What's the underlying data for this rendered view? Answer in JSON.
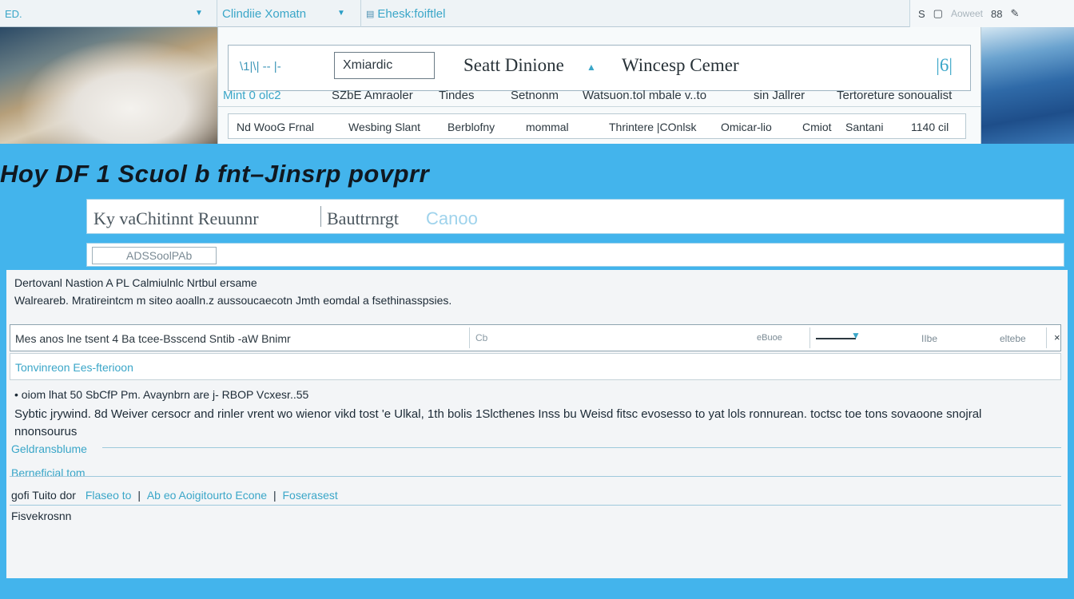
{
  "tabs": [
    {
      "label": "ED.",
      "chev": "▼"
    },
    {
      "label": "Clindiie Xomatn",
      "chev": "▼"
    },
    {
      "label": "Ehesk:foiftlel",
      "icon": "doc-icon"
    }
  ],
  "toolbar": {
    "item1": "S",
    "item2": "▢",
    "item3": "Aoweet",
    "item4": "88",
    "item5": "✎"
  },
  "panel": {
    "row1": {
      "left": "\\1|\\| -- |-",
      "box": "Xmiardic",
      "big1": "Seatt Dinione",
      "chev": "▲",
      "big2": "Wincesp Cemer",
      "end": "|6|"
    },
    "row2": {
      "a": "Mint 0 olc2",
      "b": "SZbE Amraoler",
      "c": "Tindes",
      "d": "Setnonm",
      "e": "Watsuon.tol mbale v..to",
      "f": "sin Jallrer",
      "g": "Tertoreture sonoualist"
    },
    "row3": {
      "a": "Nd WooG Frnal",
      "b": "Wesbing Slant",
      "c": "Berblofny",
      "d": "mommal",
      "e": "Thrintere |COnlsk",
      "f": "Omicar-lio",
      "g": "Cmiot",
      "h": "Santani",
      "i": "1140 cil"
    }
  },
  "heading": "Hoy DF 1 Scuol b fnt–Jinsrp povprr",
  "strip1": {
    "t1": "Ky vaChitinnt Reuunnr",
    "t2": "Bauttrnrgt",
    "t3": "Canoo"
  },
  "strip2": {
    "btn": "ADSSoolPAb"
  },
  "main": {
    "desc1": "Dertovanl Nastion  A PL Calmiulnlc  Nrtbul ersame",
    "desc2": "Walreareb.  Mratireintcm m siteo aoalln.z aussoucaecotn Jmth eomdal a fsethinasspsies.",
    "search": {
      "label": "Mes anos lne tsent  4 Ba tcee-Bsscend Sntib -aW Bnimr",
      "field": "Cb",
      "mid": "eBuoe",
      "lbl1": "IIbe",
      "lbl2": "eltebe"
    },
    "sub": "Tonvinreon  Ees-fterioon",
    "bullet": "• oiom lhat 50 SbCfP Pm. Avaynbrn are j- RBOP Vcxesr..55",
    "para": "Sybtic jrywind. 8d Weiver cersocr and rinler vrent wo wienor vikd tost 'e Ulkal, 1th bolis 1Slcthenes Inss bu Weisd fitsc evosesso to yat lols ronnurean. toctsc toe tons sovaoone snojral nnonsourus",
    "sec1": "Geldransblume",
    "sec2": "Berneficial tom",
    "links": {
      "a": "gofi Tuito dor",
      "b": "Flaseo to",
      "c": "Ab eo Aoigitourto  Econe",
      "d": "Foserasest"
    },
    "last": "Fisvekrosnn"
  }
}
